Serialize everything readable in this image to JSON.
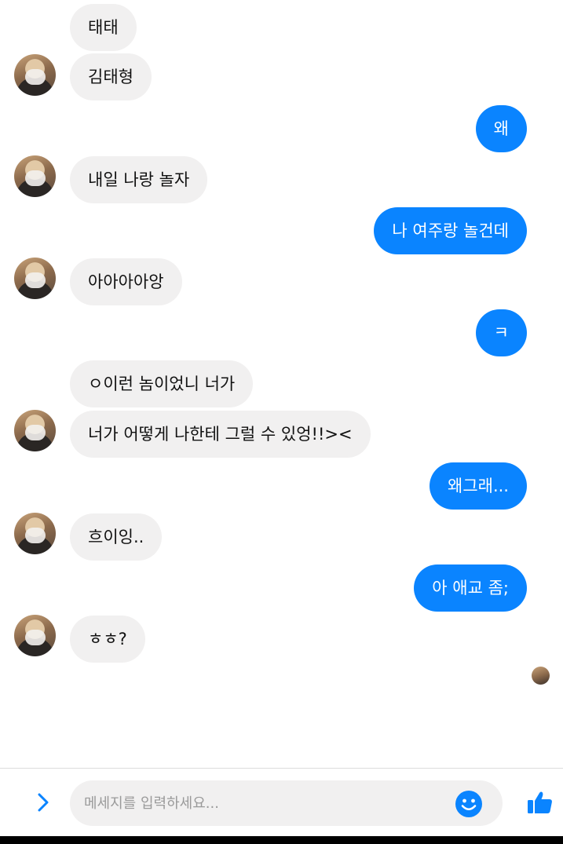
{
  "messages": [
    {
      "from": "other",
      "text": "태태"
    },
    {
      "from": "other",
      "text": "김태형"
    },
    {
      "from": "me",
      "text": "왜"
    },
    {
      "from": "other",
      "text": "내일 나랑 놀자"
    },
    {
      "from": "me",
      "text": "나 여주랑 놀건데"
    },
    {
      "from": "other",
      "text": "아아아아앙"
    },
    {
      "from": "me",
      "text": "ㅋ"
    },
    {
      "from": "other",
      "text": "ㅇ이런 놈이었니 너가"
    },
    {
      "from": "other",
      "text": "너가 어떻게 나한테 그럴 수 있엉!!><"
    },
    {
      "from": "me",
      "text": "왜그래..."
    },
    {
      "from": "other",
      "text": "흐이잉.."
    },
    {
      "from": "me",
      "text": "아 애교 좀;"
    },
    {
      "from": "other",
      "text": "ㅎㅎ?"
    }
  ],
  "composer": {
    "placeholder": "메세지를 입력하세요...",
    "value": ""
  },
  "icons": {
    "expand": "chevron-right-icon",
    "emoji": "smiley-icon",
    "like": "thumbs-up-icon"
  },
  "colors": {
    "accent": "#0a84ff",
    "incoming_bubble": "#f1f0f0"
  }
}
